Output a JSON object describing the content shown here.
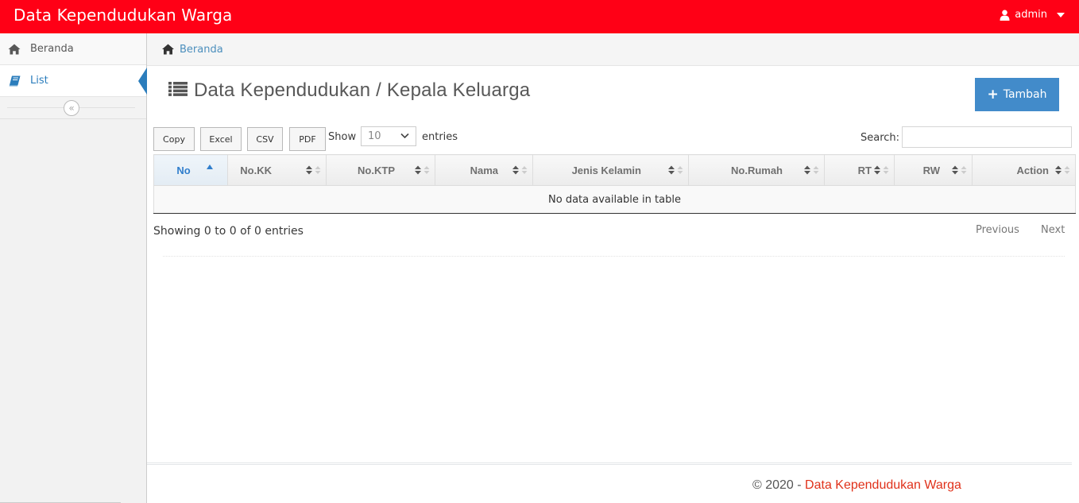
{
  "navbar": {
    "brand": "Data Kependudukan Warga",
    "user": {
      "name": "admin",
      "icon": "user-icon"
    }
  },
  "sidebar": {
    "items": [
      {
        "label": "Beranda",
        "icon": "home-icon",
        "active": false
      },
      {
        "label": "List",
        "icon": "book-icon",
        "active": true
      }
    ],
    "collapse_icon": "double-chevron-left-icon"
  },
  "breadcrumb": {
    "icon": "home-icon",
    "label": "Beranda"
  },
  "page": {
    "title": "Data Kependudukan / Kepala Keluarga",
    "title_icon": "list-icon",
    "add_button": "Tambah"
  },
  "toolbar": {
    "buttons": [
      "Copy",
      "Excel",
      "CSV",
      "PDF"
    ],
    "show_label": "Show",
    "page_size": "10",
    "entries_label": "entries",
    "search_label": "Search:",
    "search_value": ""
  },
  "table": {
    "columns": [
      "No",
      "No.KK",
      "No.KTP",
      "Nama",
      "Jenis Kelamin",
      "No.Rumah",
      "RT",
      "RW",
      "Action"
    ],
    "sorted_column": "No",
    "empty_message": "No data available in table",
    "info": "Showing 0 to 0 of 0 entries",
    "previous": "Previous",
    "next": "Next"
  },
  "footer": {
    "copyright": "© 2020 - ",
    "brand": "Data Kependudukan Warga"
  },
  "colors": {
    "navbar": "#ff0016",
    "primary": "#428bca",
    "link": "#4c8fbd",
    "footer_brand": "#e0311a"
  }
}
